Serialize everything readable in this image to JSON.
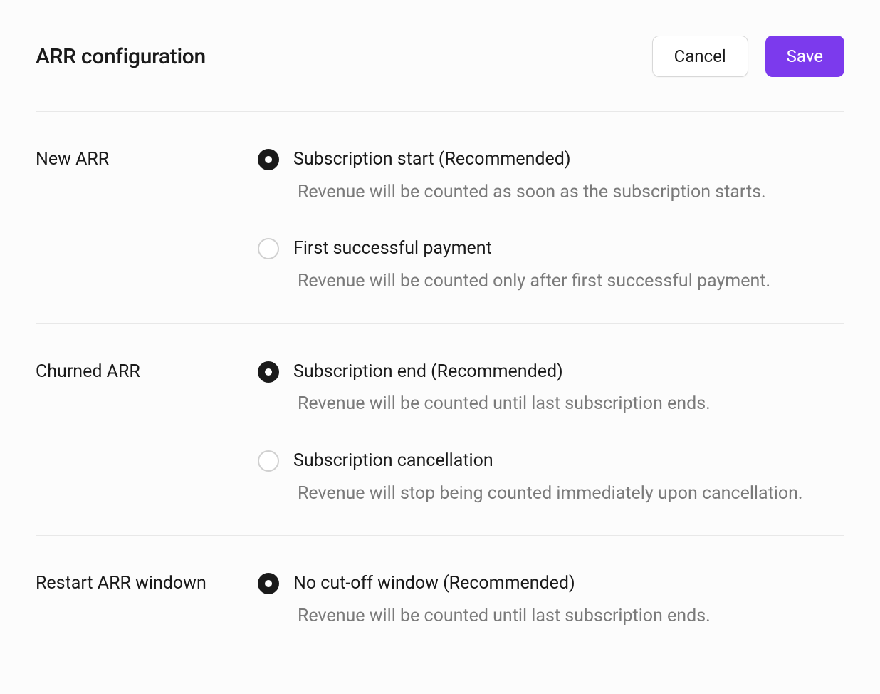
{
  "header": {
    "title": "ARR configuration",
    "cancel_label": "Cancel",
    "save_label": "Save"
  },
  "sections": [
    {
      "label": "New ARR",
      "options": [
        {
          "title": "Subscription start (Recommended)",
          "desc": "Revenue will be counted as soon as the subscription starts.",
          "selected": true
        },
        {
          "title": "First successful payment",
          "desc": "Revenue will be counted only after first successful payment.",
          "selected": false
        }
      ]
    },
    {
      "label": "Churned ARR",
      "options": [
        {
          "title": "Subscription end (Recommended)",
          "desc": "Revenue will be counted until last subscription ends.",
          "selected": true
        },
        {
          "title": "Subscription cancellation",
          "desc": "Revenue will stop being counted immediately upon cancellation.",
          "selected": false
        }
      ]
    },
    {
      "label": "Restart ARR windown",
      "options": [
        {
          "title": "No cut-off window  (Recommended)",
          "desc": "Revenue will be counted until last subscription ends.",
          "selected": true
        }
      ]
    }
  ]
}
